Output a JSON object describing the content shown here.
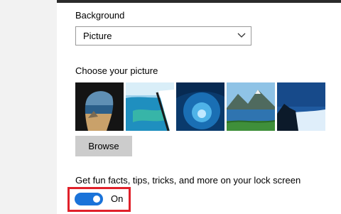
{
  "background": {
    "label": "Background",
    "selected": "Picture"
  },
  "picture": {
    "label": "Choose your picture",
    "thumbnails": [
      "cave-beach",
      "coastline-aerial",
      "ice-cave",
      "mountain-lake",
      "night-sky-cliff"
    ],
    "browse_label": "Browse"
  },
  "fun_facts": {
    "label": "Get fun facts, tips, tricks, and more on your lock screen",
    "state": "On",
    "enabled": true,
    "highlight_color": "#e0202a"
  },
  "colors": {
    "accent": "#1a73d9"
  },
  "icons": {
    "dropdown": "chevron-down-icon"
  }
}
